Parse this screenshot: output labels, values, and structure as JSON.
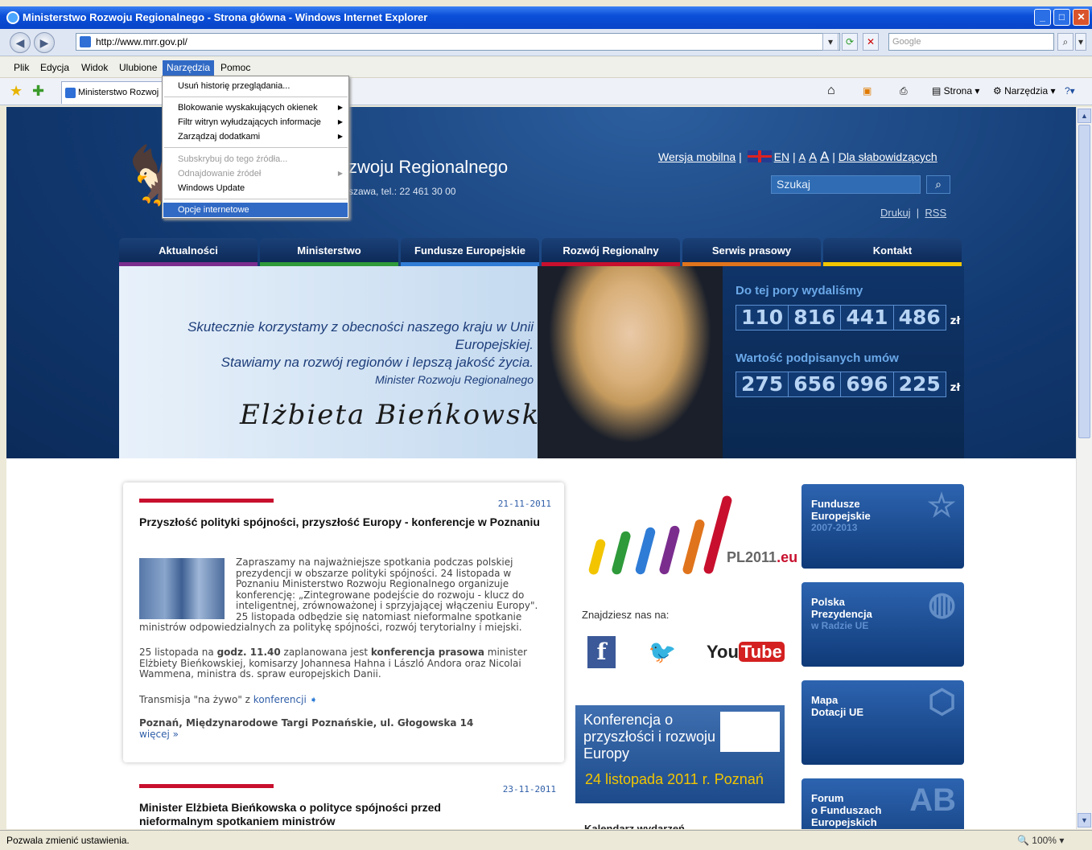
{
  "window": {
    "title": "Ministerstwo Rozwoju Regionalnego - Strona główna - Windows Internet Explorer",
    "buttons": {
      "minimize": "_",
      "maximize": "□",
      "close": "✕"
    }
  },
  "address_bar": {
    "url": "http://www.mrr.gov.pl/",
    "search_placeholder": "Google"
  },
  "menu": [
    "Plik",
    "Edycja",
    "Widok",
    "Ulubione",
    "Narzędzia",
    "Pomoc"
  ],
  "active_menu": "Narzędzia",
  "tab": {
    "title": "Ministerstwo Rozwoj"
  },
  "command_bar": {
    "page": "Strona",
    "tools": "Narzędzia"
  },
  "dropdown": {
    "items": [
      {
        "label": "Usuń historię przeglądania...",
        "disabled": false,
        "submenu": false
      },
      {
        "label": "Blokowanie wyskakujących okienek",
        "disabled": false,
        "submenu": true
      },
      {
        "label": "Filtr witryn wyłudzających informacje",
        "disabled": false,
        "submenu": true
      },
      {
        "label": "Zarządzaj dodatkami",
        "disabled": false,
        "submenu": true
      },
      {
        "label": "Subskrybuj do tego źródła...",
        "disabled": true,
        "submenu": false
      },
      {
        "label": "Odnajdowanie źródeł",
        "disabled": true,
        "submenu": true
      },
      {
        "label": "Windows Update",
        "disabled": false,
        "submenu": false
      },
      {
        "label": "Opcje internetowe",
        "disabled": false,
        "submenu": false,
        "selected": true
      }
    ]
  },
  "site": {
    "title_visible": "zwoju Regionalnego",
    "address_visible": "szawa, tel.: 22 461 30 00",
    "top_links": {
      "mobile": "Wersja mobilna",
      "en": "EN",
      "font_sizes": [
        "A",
        "A",
        "A"
      ],
      "accessible": "Dla słabowidzących"
    },
    "search_placeholder": "Szukaj",
    "print": "Drukuj",
    "rss": "RSS",
    "nav": [
      {
        "label": "Aktualności",
        "color": "#7b2d8e"
      },
      {
        "label": "Ministerstwo",
        "color": "#2e9a3a"
      },
      {
        "label": "Fundusze Europejskie",
        "color": "#2f7cd6"
      },
      {
        "label": "Rozwój Regionalny",
        "color": "#c8102e"
      },
      {
        "label": "Serwis prasowy",
        "color": "#e0741c"
      },
      {
        "label": "Kontakt",
        "color": "#f2c500"
      }
    ],
    "banner": {
      "quote_line1": "Skutecznie korzystamy z obecności naszego kraju w Unii Europejskiej.",
      "quote_line2": "Stawiamy na rozwój regionów i lepszą jakość życia.",
      "role": "Minister Rozwoju Regionalnego",
      "signature": "Elżbieta Bieńkowska"
    },
    "counters": {
      "spent_label": "Do tej pory wydaliśmy",
      "spent_groups": [
        "110",
        "816",
        "441",
        "486"
      ],
      "contracts_label": "Wartość podpisanych umów",
      "contracts_groups": [
        "275",
        "656",
        "696",
        "225"
      ],
      "unit": "zł"
    },
    "news": [
      {
        "date": "21-11-2011",
        "title": "Przyszłość polityki spójności, przyszłość Europy - konferencje w Poznaniu",
        "body": "Zapraszamy na najważniejsze spotkania podczas polskiej prezydencji w obszarze polityki spójności. 24 listopada w Poznaniu Ministerstwo Rozwoju Regionalnego organizuje konferencję: „Zintegrowane podejście do rozwoju - klucz do inteligentnej, zrównoważonej i sprzyjającej włączeniu Europy\". 25 listopada odbędzie się natomiast nieformalne spotkanie ministrów odpowiedzialnych za politykę spójności, rozwój terytorialny i miejski.",
        "body2_pre": "25 listopada na ",
        "body2_b1": "godz. 11.40",
        "body2_mid": " zaplanowana jest ",
        "body2_b2": "konferencja prasowa",
        "body2_post": " minister Elżbiety Bieńkowskiej, komisarzy Johannesa Hahna i László Andora oraz Nicolai Wammena, ministra ds. spraw europejskich Danii.",
        "live_pre": "Transmisja \"na żywo\" z ",
        "live_link": "konferencji",
        "place": "Poznań, Międzynarodowe Targi Poznańskie, ul. Głogowska 14",
        "more": "więcej »"
      },
      {
        "date": "23-11-2011",
        "title": "Minister Elżbieta Bieńkowska o polityce spójności przed nieformalnym spotkaniem ministrów"
      }
    ],
    "pl2011": {
      "text": "PL2011",
      "tld": ".eu"
    },
    "find_us": "Znajdziesz nas na:",
    "social": {
      "facebook": "f",
      "twitter": "🐦",
      "youtube_you": "You",
      "youtube_tube": "Tube"
    },
    "conference": {
      "title": "Konferencja o przyszłości i rozwoju Europy",
      "date": "24 listopada 2011 r. Poznań"
    },
    "calendar": "Kalendarz wydarzeń",
    "sideboxes": [
      {
        "line1": "Fundusze",
        "line2": "Europejskie",
        "sub": "2007-2013"
      },
      {
        "line1": "Polska",
        "line2": "Prezydencja",
        "sub": "w Radzie UE"
      },
      {
        "line1": "Mapa",
        "line2": "Dotacji UE",
        "sub": ""
      },
      {
        "line1": "Forum",
        "line2": "o Funduszach",
        "sub": "Europejskich"
      }
    ]
  },
  "status": {
    "text": "Pozwala zmienić ustawienia.",
    "zoom": "100%"
  }
}
